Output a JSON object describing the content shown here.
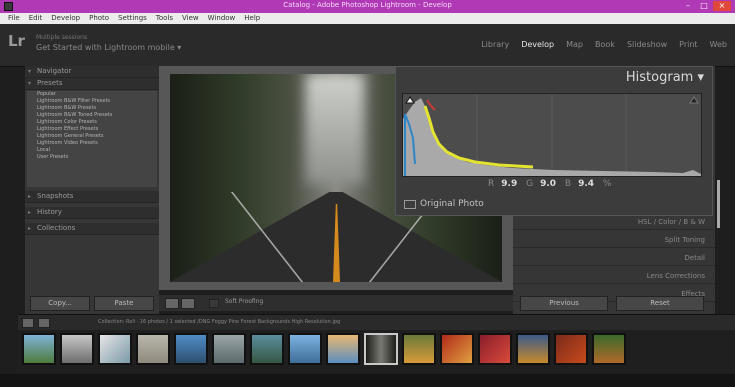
{
  "window": {
    "title": "Catalog - Adobe Photoshop Lightroom - Develop",
    "minimize": "–",
    "maximize": "□",
    "close": "×"
  },
  "menu": [
    "File",
    "Edit",
    "Develop",
    "Photo",
    "Settings",
    "Tools",
    "View",
    "Window",
    "Help"
  ],
  "identity": {
    "line1": "Multiple sessions",
    "line2": "Get Started with Lightroom mobile ▾"
  },
  "modules": [
    "Library",
    "Develop",
    "Map",
    "Book",
    "Slideshow",
    "Print",
    "Web"
  ],
  "active_module": "Develop",
  "left_panel": {
    "navigator": "Navigator",
    "presets": "Presets",
    "preset_items": [
      "Popular",
      "Lightroom B&W Filter Presets",
      "Lightroom B&W Presets",
      "Lightroom B&W Toned Presets",
      "Lightroom Color Presets",
      "Lightroom Effect Presets",
      "Lightroom General Presets",
      "Lightroom Video Presets",
      "Local",
      "User Presets"
    ],
    "snapshots": "Snapshots",
    "history": "History",
    "collections": "Collections",
    "copy": "Copy...",
    "paste": "Paste"
  },
  "toolbar": {
    "soft_proofing": "Soft Proofing"
  },
  "histogram": {
    "title": "Histogram ▾",
    "r_label": "R",
    "r_value": "9.9",
    "g_label": "G",
    "g_value": "9.0",
    "b_label": "B",
    "b_value": "9.4",
    "unit": "%",
    "original_photo": "Original Photo"
  },
  "right_panel": {
    "hsl": "HSL / Color / B & W",
    "split_toning": "Split Toning",
    "detail": "Detail",
    "lens_corrections": "Lens Corrections",
    "effects": "Effects",
    "previous": "Previous",
    "reset": "Reset"
  },
  "filmstrip": {
    "path": "Collection: Roll · 16 photos / 1 selected /DNG Foggy Pine Forest Backgrounds High Resolution.jpg",
    "thumb_count": 16
  }
}
